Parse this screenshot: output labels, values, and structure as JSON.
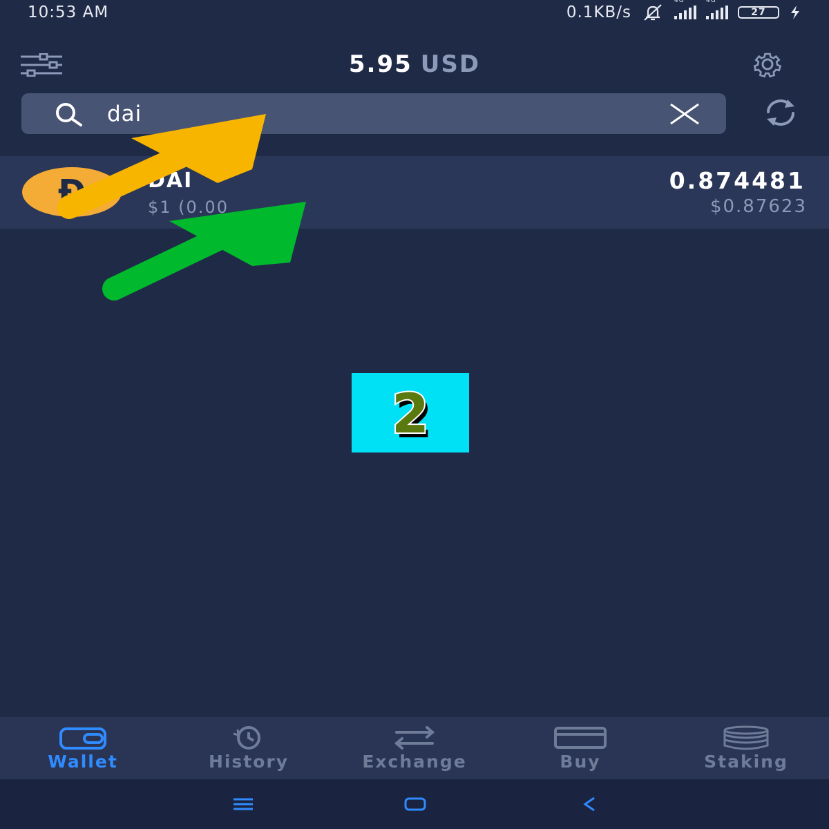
{
  "status_bar": {
    "time": "10:53 AM",
    "net_speed": "0.1KB/s",
    "network_label_1": "4G",
    "network_label_2": "4G",
    "battery": "27"
  },
  "header": {
    "balance_value": "5.95",
    "balance_currency": "USD"
  },
  "search": {
    "value": "dai",
    "placeholder": ""
  },
  "assets": [
    {
      "symbol": "DAI",
      "price_text": "$1 (0.00",
      "amount": "0.874481",
      "fiat_value": "$0.87623"
    }
  ],
  "overlay": {
    "watermark_text": "2",
    "arrow_colors": [
      "#f7b500",
      "#00b92c"
    ]
  },
  "bottom_nav": {
    "items": [
      {
        "label": "Wallet",
        "icon": "wallet-icon",
        "active": true
      },
      {
        "label": "History",
        "icon": "history-icon",
        "active": false
      },
      {
        "label": "Exchange",
        "icon": "exchange-icon",
        "active": false
      },
      {
        "label": "Buy",
        "icon": "card-icon",
        "active": false
      },
      {
        "label": "Staking",
        "icon": "coins-stack-icon",
        "active": false
      }
    ]
  },
  "colors": {
    "background": "#1f2a47",
    "accent": "#2f8bff",
    "dai_logo": "#f5ac37"
  }
}
